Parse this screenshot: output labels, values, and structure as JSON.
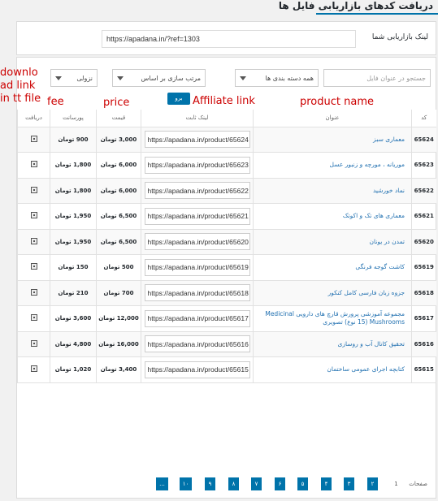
{
  "header": {
    "title": "دریافت کدهای بازاریابی فایل ها"
  },
  "affiliate_panel": {
    "label": "لینک بازاریابی شما",
    "value": "https://apadana.in/?ref=1303"
  },
  "filters": {
    "search_placeholder": "جستجو در عنوان فایل",
    "category_value": "همه دسته بندی ها",
    "sort_value": "مرتب سازی بر اساس",
    "order_value": "نزولی",
    "go_label": "برو"
  },
  "table": {
    "headers": {
      "code": "کد",
      "title": "عنوان",
      "link": "لینک ثابت",
      "price": "قیمت",
      "fee": "پورسانت",
      "download": "دریافت"
    },
    "rows": [
      {
        "code": "65624",
        "title": "معماری سبز",
        "link": "https://apadana.in/product/65624",
        "price": "3,000 تومان",
        "fee": "900 تومان"
      },
      {
        "code": "65623",
        "title": "موریانه ، مورچه و زنبور عسل",
        "link": "https://apadana.in/product/65623",
        "price": "6,000 تومان",
        "fee": "1,800 تومان"
      },
      {
        "code": "65622",
        "title": "نماد خورشید",
        "link": "https://apadana.in/product/65622",
        "price": "6,000 تومان",
        "fee": "1,800 تومان"
      },
      {
        "code": "65621",
        "title": "معماری های تک و اکوتک",
        "link": "https://apadana.in/product/65621",
        "price": "6,500 تومان",
        "fee": "1,950 تومان"
      },
      {
        "code": "65620",
        "title": "تمدن در یونان",
        "link": "https://apadana.in/product/65620",
        "price": "6,500 تومان",
        "fee": "1,950 تومان"
      },
      {
        "code": "65619",
        "title": "کاشت گوجه فرنگی",
        "link": "https://apadana.in/product/65619",
        "price": "500 تومان",
        "fee": "150 تومان"
      },
      {
        "code": "65618",
        "title": "جزوه زبان فارسی کامل کنکور",
        "link": "https://apadana.in/product/65618",
        "price": "700 تومان",
        "fee": "210 تومان"
      },
      {
        "code": "65617",
        "title": "مجموعه آموزشی پرورش قارچ های دارویی Medicinal Mushrooms (15 نوع) تصویری",
        "link": "https://apadana.in/product/65617",
        "price": "12,000 تومان",
        "fee": "3,600 تومان"
      },
      {
        "code": "65616",
        "title": "تحقیق کانال آب و روسازی",
        "link": "https://apadana.in/product/65616",
        "price": "16,000 تومان",
        "fee": "4,800 تومان"
      },
      {
        "code": "65615",
        "title": "کتابچه اجرای عمومی ساختمان",
        "link": "https://apadana.in/product/65615",
        "price": "3,400 تومان",
        "fee": "1,020 تومان"
      }
    ]
  },
  "pagination": {
    "label": "صفحات",
    "current": "1",
    "pages": [
      "۲",
      "۳",
      "۴",
      "۵",
      "۶",
      "۷",
      "۸",
      "۹",
      "۱۰",
      "..."
    ]
  },
  "annotations": {
    "download": "download link in tt file",
    "fee": "fee",
    "price": "price",
    "affiliate": "Affiliate link",
    "product": "product name"
  },
  "colors": {
    "accent": "#0073aa",
    "link": "#2271b1",
    "annotation": "#cc0000"
  }
}
